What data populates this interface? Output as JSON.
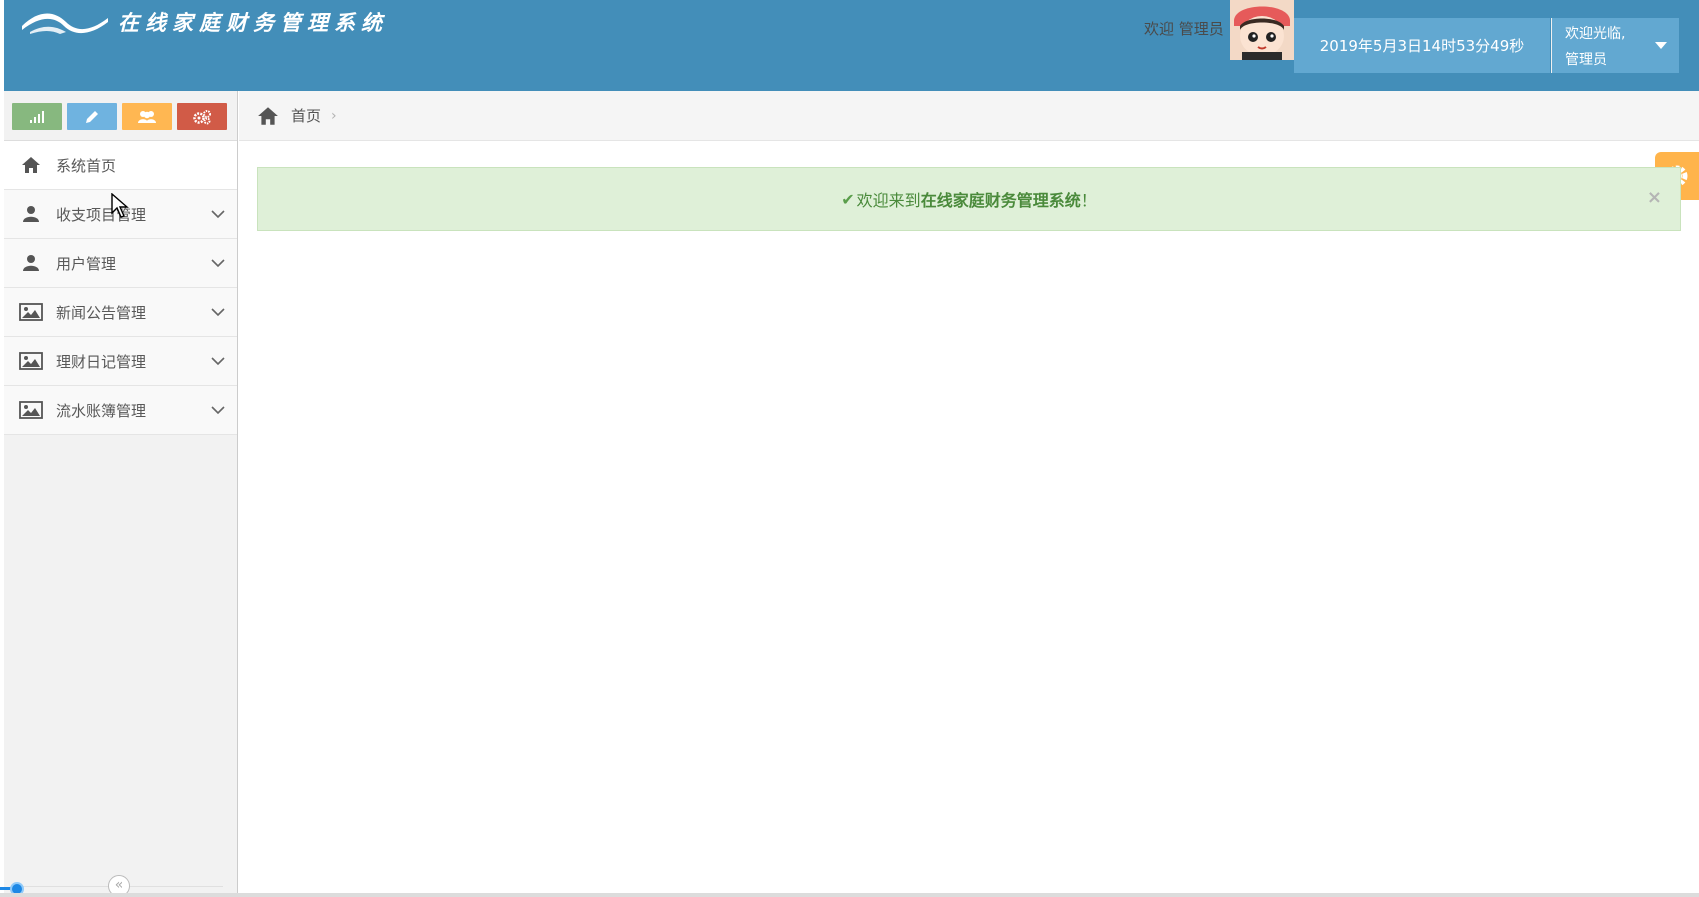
{
  "header": {
    "title": "在线家庭财务管理系统",
    "greeting": "欢迎 管理员",
    "datetime": "2019年5月3日14时53分49秒",
    "user_menu": {
      "line1": "欢迎光临,",
      "line2": "管理员"
    }
  },
  "shortcuts": [
    {
      "icon": "signal-icon",
      "color": "#87b87f"
    },
    {
      "icon": "pencil-icon",
      "color": "#6fb3e0"
    },
    {
      "icon": "group-icon",
      "color": "#ffb752"
    },
    {
      "icon": "cogs-icon",
      "color": "#d15b47"
    }
  ],
  "sidebar": {
    "items": [
      {
        "label": "系统首页",
        "icon": "home-icon",
        "expandable": false
      },
      {
        "label": "收支项目管理",
        "icon": "user-icon",
        "expandable": true
      },
      {
        "label": "用户管理",
        "icon": "user-icon",
        "expandable": true
      },
      {
        "label": "新闻公告管理",
        "icon": "picture-icon",
        "expandable": true
      },
      {
        "label": "理财日记管理",
        "icon": "picture-icon",
        "expandable": true
      },
      {
        "label": "流水账簿管理",
        "icon": "picture-icon",
        "expandable": true
      }
    ],
    "collapse_glyph": "«"
  },
  "breadcrumb": {
    "home": "首页",
    "separator": "›"
  },
  "alert": {
    "check": "✔",
    "prefix": "欢迎来到",
    "system_name": "在线家庭财务管理系统",
    "suffix": "！",
    "close": "×"
  }
}
